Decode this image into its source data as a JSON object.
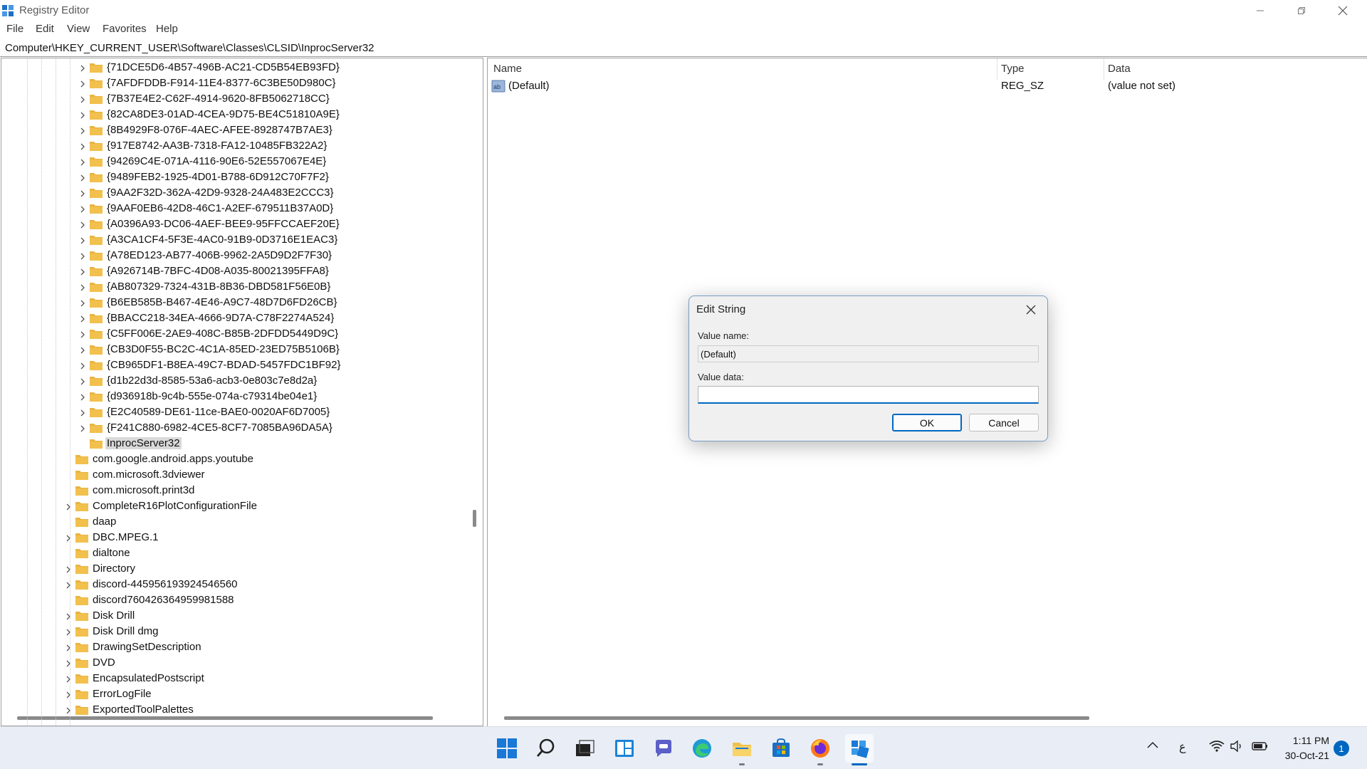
{
  "window": {
    "title": "Registry Editor"
  },
  "menu": [
    "File",
    "Edit",
    "View",
    "Favorites",
    "Help"
  ],
  "address": "Computer\\HKEY_CURRENT_USER\\Software\\Classes\\CLSID\\InprocServer32",
  "tree": {
    "clsid_children": [
      "{71DCE5D6-4B57-496B-AC21-CD5B54EB93FD}",
      "{7AFDFDDB-F914-11E4-8377-6C3BE50D980C}",
      "{7B37E4E2-C62F-4914-9620-8FB5062718CC}",
      "{82CA8DE3-01AD-4CEA-9D75-BE4C51810A9E}",
      "{8B4929F8-076F-4AEC-AFEE-8928747B7AE3}",
      "{917E8742-AA3B-7318-FA12-10485FB322A2}",
      "{94269C4E-071A-4116-90E6-52E557067E4E}",
      "{9489FEB2-1925-4D01-B788-6D912C70F7F2}",
      "{9AA2F32D-362A-42D9-9328-24A483E2CCC3}",
      "{9AAF0EB6-42D8-46C1-A2EF-679511B37A0D}",
      "{A0396A93-DC06-4AEF-BEE9-95FFCCAEF20E}",
      "{A3CA1CF4-5F3E-4AC0-91B9-0D3716E1EAC3}",
      "{A78ED123-AB77-406B-9962-2A5D9D2F7F30}",
      "{A926714B-7BFC-4D08-A035-80021395FFA8}",
      "{AB807329-7324-431B-8B36-DBD581F56E0B}",
      "{B6EB585B-B467-4E46-A9C7-48D7D6FD26CB}",
      "{BBACC218-34EA-4666-9D7A-C78F2274A524}",
      "{C5FF006E-2AE9-408C-B85B-2DFDD5449D9C}",
      "{CB3D0F55-BC2C-4C1A-85ED-23ED75B5106B}",
      "{CB965DF1-B8EA-49C7-BDAD-5457FDC1BF92}",
      "{d1b22d3d-8585-53a6-acb3-0e803c7e8d2a}",
      "{d936918b-9c4b-555e-074a-c79314be04e1}",
      "{E2C40589-DE61-11ce-BAE0-0020AF6D7005}",
      "{F241C880-6982-4CE5-8CF7-7085BA96DA5A}"
    ],
    "selected": "InprocServer32",
    "classes_children": [
      {
        "label": "com.google.android.apps.youtube",
        "expandable": false
      },
      {
        "label": "com.microsoft.3dviewer",
        "expandable": false
      },
      {
        "label": "com.microsoft.print3d",
        "expandable": false
      },
      {
        "label": "CompleteR16PlotConfigurationFile",
        "expandable": true
      },
      {
        "label": "daap",
        "expandable": false
      },
      {
        "label": "DBC.MPEG.1",
        "expandable": true
      },
      {
        "label": "dialtone",
        "expandable": false
      },
      {
        "label": "Directory",
        "expandable": true
      },
      {
        "label": "discord-445956193924546560",
        "expandable": true
      },
      {
        "label": "discord760426364959981588",
        "expandable": false
      },
      {
        "label": "Disk Drill",
        "expandable": true
      },
      {
        "label": "Disk Drill dmg",
        "expandable": true
      },
      {
        "label": "DrawingSetDescription",
        "expandable": true
      },
      {
        "label": "DVD",
        "expandable": true
      },
      {
        "label": "EncapsulatedPostscript",
        "expandable": true
      },
      {
        "label": "ErrorLogFile",
        "expandable": true
      },
      {
        "label": "ExportedToolPalettes",
        "expandable": true
      }
    ]
  },
  "values": {
    "columns": {
      "name": "Name",
      "type": "Type",
      "data": "Data"
    },
    "rows": [
      {
        "name": "(Default)",
        "type": "REG_SZ",
        "data": "(value not set)"
      }
    ]
  },
  "dialog": {
    "title": "Edit String",
    "value_name_label": "Value name:",
    "value_name": "(Default)",
    "value_data_label": "Value data:",
    "value_data": "",
    "ok": "OK",
    "cancel": "Cancel"
  },
  "taskbar": {
    "apps": [
      "start-icon",
      "search-icon",
      "task-view-icon",
      "widgets-icon",
      "chat-icon",
      "edge-icon",
      "file-explorer-icon",
      "store-icon",
      "firefox-icon",
      "regedit-icon"
    ],
    "tray": {
      "input_indicator": "ع",
      "time": "1:11 PM",
      "date": "30-Oct-21",
      "notifications": "1"
    }
  },
  "colors": {
    "accent": "#0067c0",
    "folder": "#f2c04c",
    "taskbar": "#e9eef6"
  }
}
